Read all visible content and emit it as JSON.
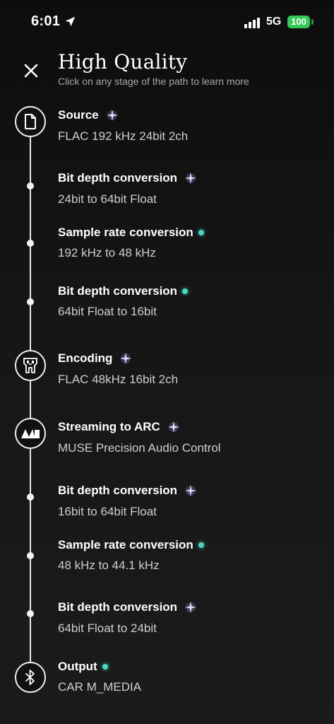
{
  "status_bar": {
    "time": "6:01",
    "network": "5G",
    "battery": "100"
  },
  "header": {
    "title": "High Quality",
    "subtitle": "Click on any stage of the path to learn more"
  },
  "colors": {
    "accent_teal": "#49d6c0",
    "sparkle": "#b9a6ff",
    "battery": "#34c759"
  },
  "stages": [
    {
      "title": "Source",
      "detail": "FLAC 192 kHz 24bit 2ch",
      "marker": "sparkle",
      "node": "document-icon"
    },
    {
      "title": "Bit depth conversion",
      "detail": "24bit to 64bit Float",
      "marker": "sparkle",
      "node": "dot"
    },
    {
      "title": "Sample rate conversion",
      "detail": "192 kHz to 48 kHz",
      "marker": "teal-dot",
      "node": "dot"
    },
    {
      "title": "Bit depth conversion",
      "detail": "64bit Float to 16bit",
      "marker": "teal-dot",
      "node": "dot"
    },
    {
      "title": "Encoding",
      "detail": "FLAC 48kHz 16bit 2ch",
      "marker": "sparkle",
      "node": "chip-icon"
    },
    {
      "title": "Streaming to ARC",
      "detail": "MUSE Precision Audio Control",
      "marker": "sparkle",
      "node": "arc-logo-icon"
    },
    {
      "title": "Bit depth conversion",
      "detail": "16bit to 64bit Float",
      "marker": "sparkle",
      "node": "dot"
    },
    {
      "title": "Sample rate conversion",
      "detail": "48 kHz to 44.1 kHz",
      "marker": "teal-dot",
      "node": "dot"
    },
    {
      "title": "Bit depth conversion",
      "detail": "64bit Float to 24bit",
      "marker": "sparkle",
      "node": "dot"
    },
    {
      "title": "Output",
      "detail": "CAR M_MEDIA",
      "marker": "teal-dot",
      "node": "bluetooth-icon"
    }
  ]
}
